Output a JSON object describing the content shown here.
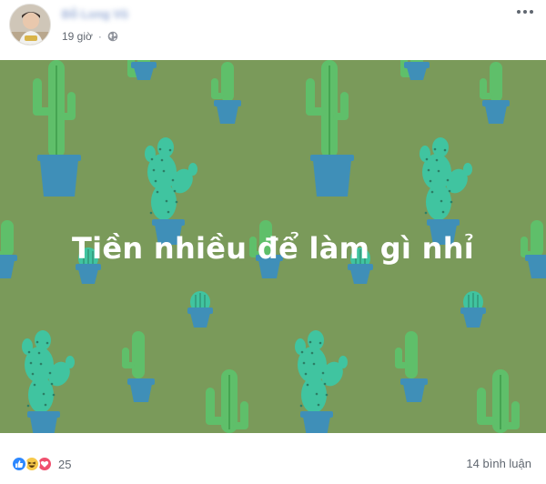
{
  "post": {
    "author_name": "Đỗ Long Vũ",
    "timestamp": "19 giờ",
    "separator": "·",
    "privacy_icon": "globe-icon",
    "more_icon": "more-options-icon"
  },
  "photo": {
    "caption": "Tiền nhiều để làm gì nhỉ",
    "colors": {
      "background": "#7a9a5a",
      "cactus_green": "#5fbf6a",
      "cactus_teal": "#40c4a0",
      "pot_blue": "#3f8fb8"
    }
  },
  "footer": {
    "reaction_icons": [
      "like-icon",
      "haha-icon",
      "love-icon"
    ],
    "reaction_count": "25",
    "comment_count": "14 bình luận"
  }
}
